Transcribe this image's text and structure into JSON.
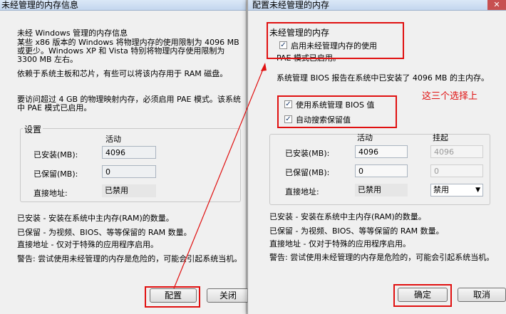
{
  "left_window": {
    "title": "未经管理的内存信息",
    "heading": "未经 Windows 管理的内存信息",
    "desc1": "某些 x86 版本的 Windows 将物理内存的使用限制为 4096 MB 或更少。Windows XP 和 Vista 特别将物理内存使用限制为 3300 MB 左右。",
    "desc2": "依赖于系统主板和芯片，有些可以将该内存用于 RAM 磁盘。",
    "desc3": "要访问超过 4 GB 的物理映射内存，必须启用 PAE 模式。该系统中 PAE 模式已启用。",
    "settings_legend": "设置",
    "col_active": "活动",
    "rows": [
      {
        "label": "已安装(MB):",
        "value": "4096"
      },
      {
        "label": "已保留(MB):",
        "value": "0"
      },
      {
        "label": "直接地址:",
        "value": "已禁用"
      }
    ],
    "legend_installed": "已安装 - 安装在系统中主内存(RAM)的数量。",
    "legend_reserved": "已保留 - 为视频、BIOS、等等保留的 RAM 数量。",
    "legend_direct": "直接地址 - 仅对于特殊的应用程序启用。",
    "warning": "警告: 尝试使用未经管理的内存是危险的，可能会引起系统当机。",
    "configure_button": "配置",
    "close_button": "关闭"
  },
  "right_window": {
    "title": "配置未经管理的内存",
    "group_legend": "未经管理的内存",
    "enable_checkbox": "启用未经管理内存的使用",
    "pae_text": "PAE 模式已启用。",
    "bios_text": "系统管理 BIOS 报告在系统中已安装了 4096 MB 的主内存。",
    "use_bios_checkbox": "使用系统管理 BIOS 值",
    "auto_search_checkbox": "自动搜索保留值",
    "annotation": "这三个选择上",
    "col_active": "活动",
    "col_suspend": "挂起",
    "rows": [
      {
        "label": "已安装(MB):",
        "active": "4096",
        "suspend": "4096"
      },
      {
        "label": "已保留(MB):",
        "active": "0",
        "suspend": "0"
      },
      {
        "label": "直接地址:",
        "active": "已禁用",
        "suspend": "禁用"
      }
    ],
    "legend_installed": "已安装 - 安装在系统中主内存(RAM)的数量。",
    "legend_reserved": "已保留 - 为视频、BIOS、等等保留的 RAM 数量。",
    "legend_direct": "直接地址 - 仅对于特殊的应用程序启用。",
    "warning": "警告: 尝试使用未经管理的内存是危险的，可能会引起系统当机。",
    "ok_button": "确定",
    "cancel_button": "取消"
  },
  "colors": {
    "highlight_red": "#e01010",
    "annotation_red": "#e01010"
  },
  "icons": {
    "close": "close-icon",
    "check": "check-icon",
    "dropdown": "chevron-down-icon"
  }
}
